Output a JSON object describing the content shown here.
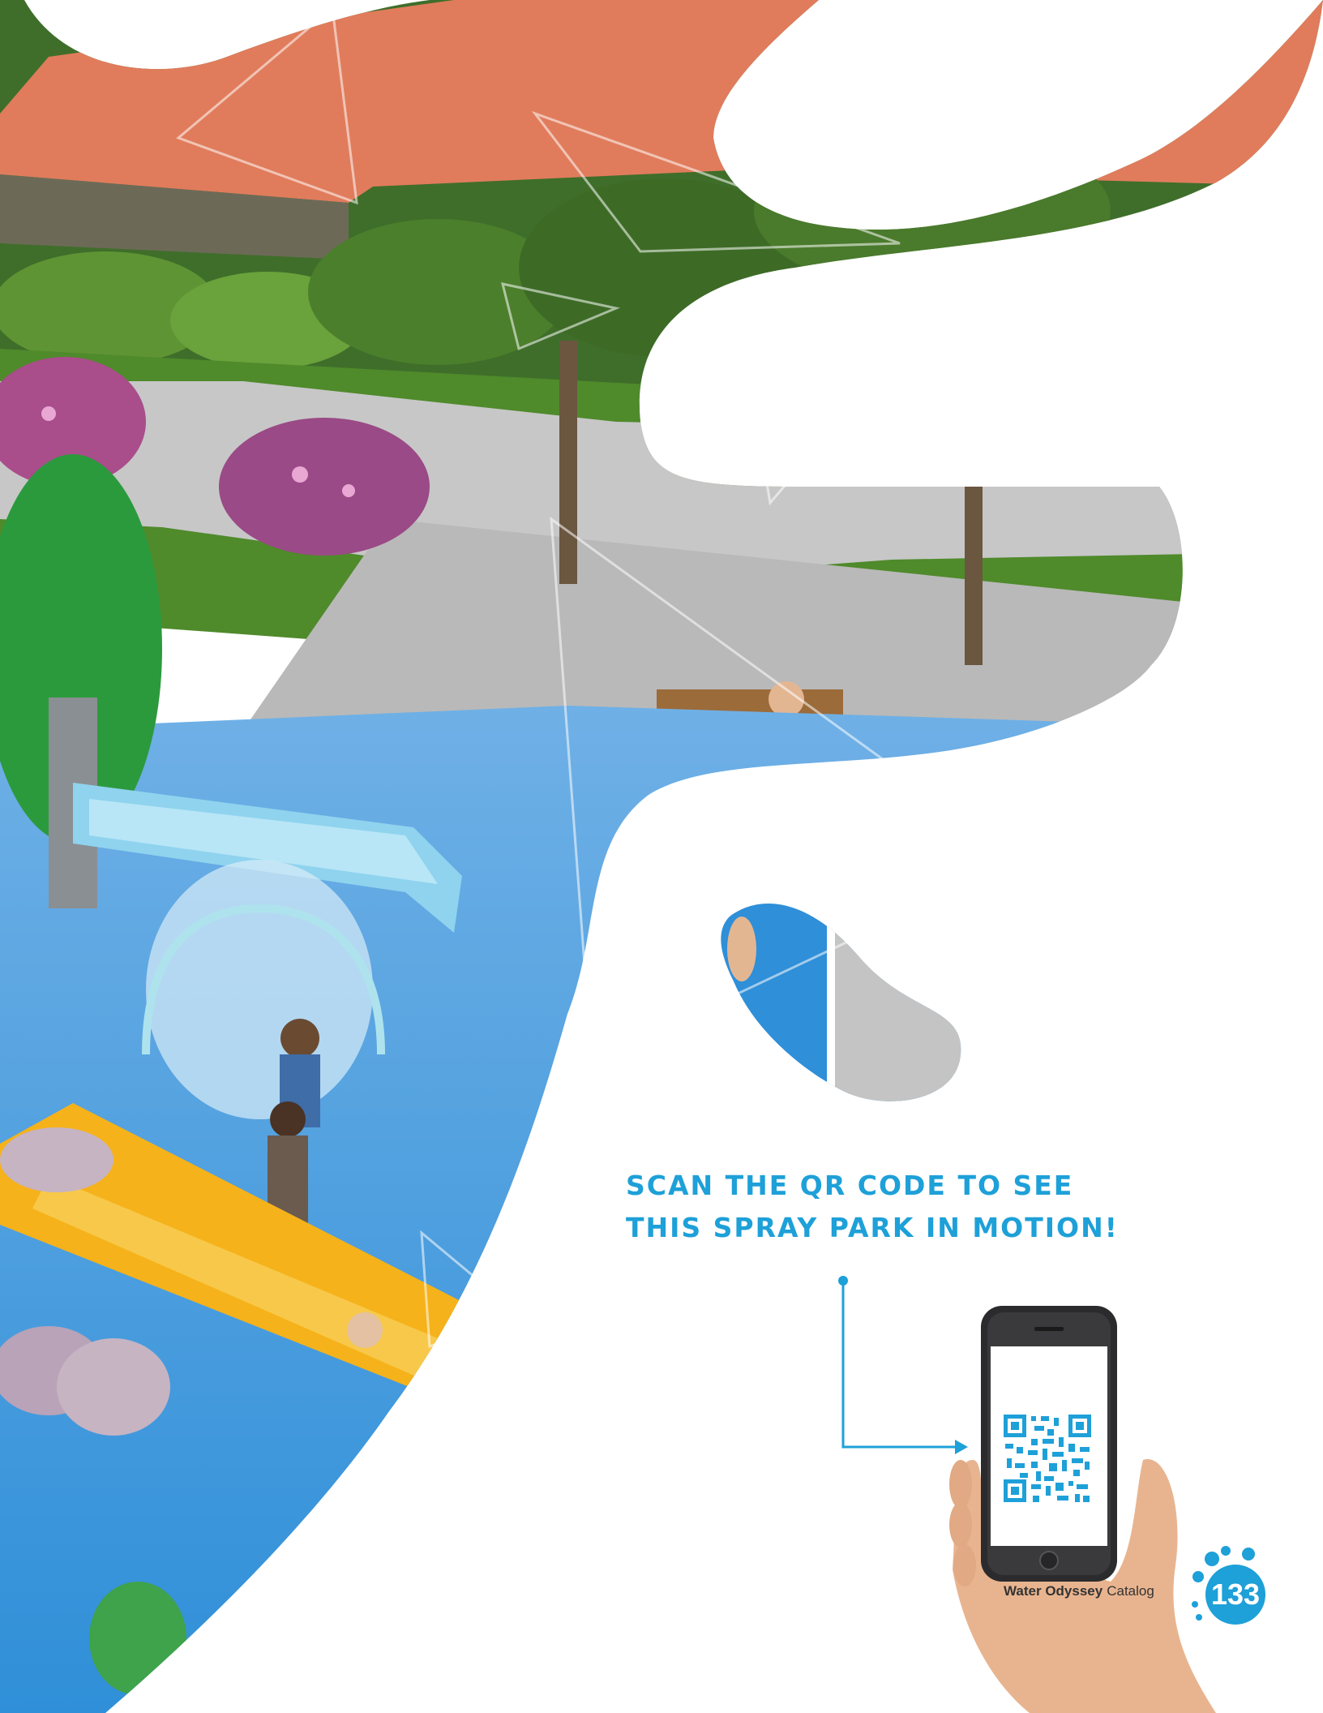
{
  "cta": {
    "line1": "SCAN THE QR CODE TO SEE",
    "line2": "THIS SPRAY PARK IN MOTION!"
  },
  "footer": {
    "brand": "Water Odyssey",
    "suffix": "Catalog",
    "page_number": "133"
  },
  "colors": {
    "accent": "#1ea0d8",
    "splash_pad": "#2f8fd8",
    "roof": "#e07c5c",
    "grass": "#4f8a2b",
    "path": "#c7c7c7",
    "slide": "#f5b21a"
  },
  "icons": [
    "qr-code-icon",
    "phone-icon",
    "hand-icon",
    "splash-badge-icon",
    "arrow-icon"
  ]
}
